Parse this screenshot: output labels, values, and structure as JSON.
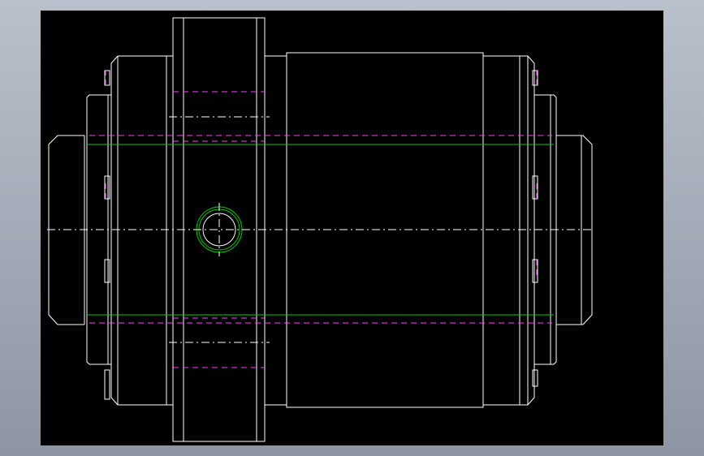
{
  "canvas": {
    "background_top": "#b9c0cb",
    "background_bottom": "#8d95a3",
    "viewport_color": "#000000"
  },
  "colors": {
    "outline": "#ffffff",
    "centerline": "#ffffff",
    "hidden_line": "#ff3cff",
    "green_line": "#00cc00"
  },
  "drawing": {
    "view": "side elevation",
    "parts": [
      "left-cap",
      "left-end-plate",
      "body-housing",
      "center-flange",
      "right-sleeve",
      "right-end-plate",
      "right-cap",
      "side-port"
    ]
  }
}
